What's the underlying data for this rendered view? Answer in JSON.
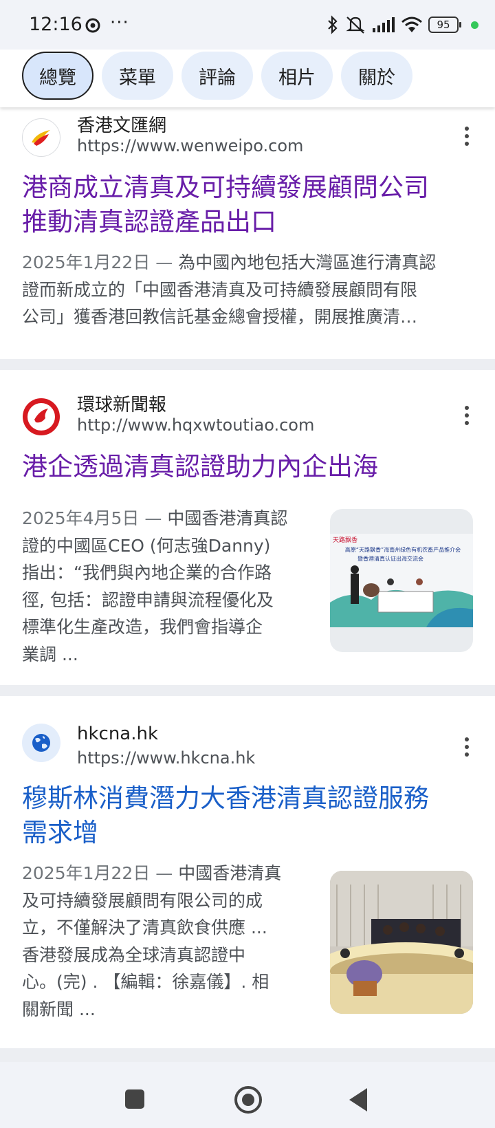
{
  "status_bar": {
    "time": "12:16",
    "more": "···",
    "battery": "95"
  },
  "tabs": [
    {
      "label": "總覽",
      "active": true
    },
    {
      "label": "菜單",
      "active": false
    },
    {
      "label": "評論",
      "active": false
    },
    {
      "label": "相片",
      "active": false
    },
    {
      "label": "關於",
      "active": false
    }
  ],
  "results": [
    {
      "site_name": "香港文匯網",
      "url": "https://www.wenweipo.com",
      "favicon": "wenweipo-logo",
      "title_lines": [
        "港商成立清真及可持續發展顧問公司",
        "推動清真認證產品出口"
      ],
      "date": "2025年1月22日",
      "dash": " — ",
      "snippet_lines": [
        "為中國內地包括大灣區進行清真認",
        "證而新成立的「中國香港清真及可持續發展顧問有限",
        "公司」獲香港回教信託基金總會授權，開展推廣清…"
      ]
    },
    {
      "site_name": "環球新聞報",
      "url": "http://www.hqxwtoutiao.com",
      "favicon": "hqxw-logo",
      "title_lines": [
        "港企透過清真認證助力內企出海"
      ],
      "date": "2025年4月5日",
      "dash": " — ",
      "snippet_lines": [
        "中國香港清真認",
        "證的中國區CEO (何志強Danny)",
        "指出：“我們與內地企業的合作路",
        "徑, 包括：認證申請與流程優化及",
        "標準化生產改造，我們會指導企",
        "業調 ..."
      ],
      "thumbnail": {
        "banner_title": "高原“天路飘香”海南州绿色有机农畜产品推介会",
        "banner_subtitle": "暨香港清真认证出海交流会",
        "logo_text": "天路飘香"
      }
    },
    {
      "site_name": "hkcna.hk",
      "url": "https://www.hkcna.hk",
      "favicon": "globe-icon",
      "title_lines": [
        "穆斯林消費潛力大香港清真認證服務",
        "需求增"
      ],
      "date": "2025年1月22日",
      "dash": " — ",
      "snippet_lines": [
        "中國香港清真",
        "及可持續發展顧問有限公司的成",
        "立，不僅解決了清真飲食供應 ...",
        "香港發展成為全球清真認證中",
        "心。(完) . 【編輯：徐嘉儀】. 相",
        "關新聞 ..."
      ]
    }
  ],
  "colors": {
    "visited_link": "#681da8",
    "link": "#1a5fc8",
    "snippet": "#4d5156",
    "tab_bg": "#e7effb"
  }
}
